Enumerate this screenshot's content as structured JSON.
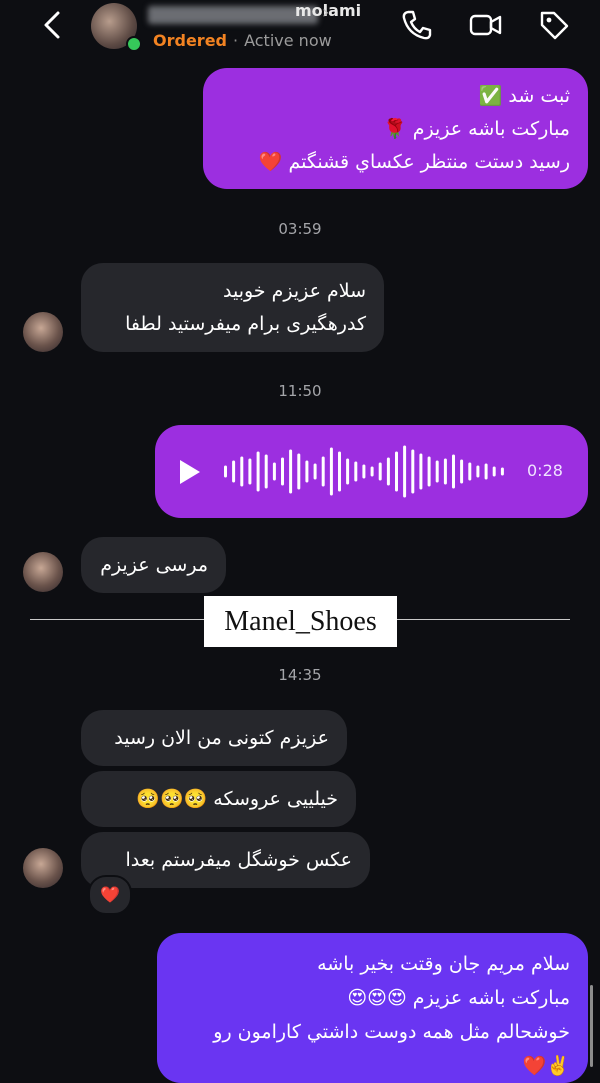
{
  "header": {
    "name_visible": "molami",
    "status_ordered": "Ordered",
    "status_active": "Active now"
  },
  "messages": {
    "m1": {
      "lines": [
        "ثبت شد ✅",
        "مبارکت باشه عزیزم 🌹",
        "رسید دستت منتظر عکساي قشنگتم ❤️"
      ]
    },
    "ts1": "03:59",
    "m2": {
      "lines": [
        "سلام عزیزم خوبید",
        "کدرهگیری برام میفرستید لطفا"
      ]
    },
    "ts2": "11:50",
    "voice": {
      "duration": "0:28"
    },
    "m3": {
      "text": "مرسی عزیزم"
    },
    "ts3": "14:35",
    "m4": {
      "text": "عزیزم کتونی من الان رسید"
    },
    "m5": {
      "text": "خیلییی عروسکه 🥺🥺🥺"
    },
    "m6": {
      "text": "عکس خوشگل میفرستم بعدا"
    },
    "reaction": "❤️",
    "m7": {
      "lines": [
        "سلام مریم جان وقتت بخیر باشه",
        "مبارکت باشه عزیزم 😍😍😍",
        "خوشحالم مثل همه دوست داشتي کارامون رو",
        "✌️❤️"
      ]
    }
  },
  "watermark": "Manel_Shoes",
  "colors": {
    "outgoing": "#9c2fe0",
    "outgoing_last": "#6a35f2",
    "incoming": "#26272c",
    "ordered": "#f28322"
  }
}
